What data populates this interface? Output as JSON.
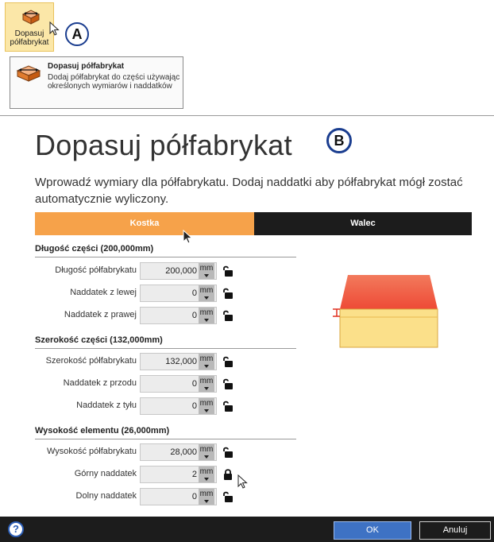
{
  "ribbon": {
    "button_line1": "Dopasuj",
    "button_line2": "półfabrykat",
    "icon": "stock-block-icon"
  },
  "badges": {
    "a": "A",
    "b": "B"
  },
  "tooltip": {
    "title": "Dopasuj półfabrykat",
    "description": "Dodaj półfabrykat do części używając określonych wymiarów i naddatków"
  },
  "dialog": {
    "title": "Dopasuj półfabrykat",
    "subtitle": "Wprowadź wymiary dla półfabrykatu. Dodaj naddatki aby półfabrykat mógł zostać automatycznie wyliczony.",
    "tabs": [
      {
        "label": "Kostka",
        "active": true
      },
      {
        "label": "Walec",
        "active": false
      }
    ],
    "sections": [
      {
        "title": "Długość części (200,000mm)",
        "rows": [
          {
            "label": "Długość półfabrykatu",
            "value": "200,000",
            "unit": "mm",
            "lock": "unlocked"
          },
          {
            "label": "Naddatek z lewej",
            "value": "0",
            "unit": "mm",
            "lock": "unlocked"
          },
          {
            "label": "Naddatek z prawej",
            "value": "0",
            "unit": "mm",
            "lock": "unlocked"
          }
        ]
      },
      {
        "title": "Szerokość części (132,000mm)",
        "rows": [
          {
            "label": "Szerokość półfabrykatu",
            "value": "132,000",
            "unit": "mm",
            "lock": "unlocked"
          },
          {
            "label": "Naddatek z przodu",
            "value": "0",
            "unit": "mm",
            "lock": "unlocked"
          },
          {
            "label": "Naddatek z tyłu",
            "value": "0",
            "unit": "mm",
            "lock": "unlocked"
          }
        ]
      },
      {
        "title": "Wysokość elementu (26,000mm)",
        "rows": [
          {
            "label": "Wysokość półfabrykatu",
            "value": "28,000",
            "unit": "mm",
            "lock": "unlocked"
          },
          {
            "label": "Górny naddatek",
            "value": "2",
            "unit": "mm",
            "lock": "locked"
          },
          {
            "label": "Dolny naddatek",
            "value": "0",
            "unit": "mm",
            "lock": "unlocked"
          }
        ]
      }
    ],
    "footer": {
      "help": "?",
      "ok": "OK",
      "cancel": "Anuluj"
    },
    "colors": {
      "active_tab": "#f6a24a",
      "dark": "#1c1c1c",
      "ok": "#3e72c4",
      "preview_top": "#ef5a3a",
      "preview_body": "#fbe08a"
    }
  }
}
